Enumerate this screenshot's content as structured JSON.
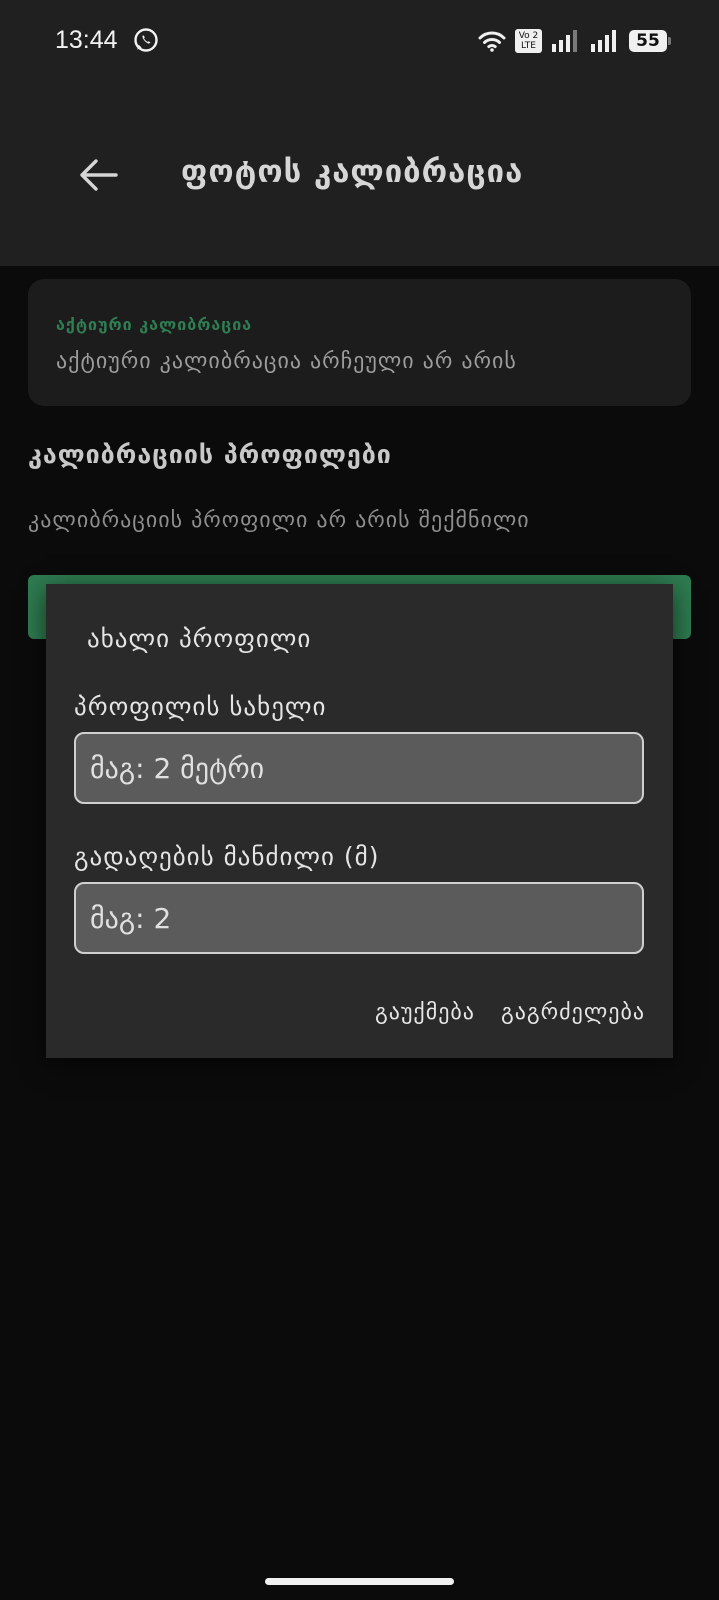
{
  "status_bar": {
    "time": "13:44",
    "volte_line1": "Vo 2",
    "volte_line2": "LTE",
    "battery": "55"
  },
  "app_bar": {
    "title": "ფოტოს კალიბრაცია"
  },
  "active_calibration": {
    "label": "აქტიური კალიბრაცია",
    "value": "აქტიური კალიბრაცია არჩეული არ არის"
  },
  "profiles": {
    "title": "კალიბრაციის პროფილები",
    "empty_text": "კალიბრაციის პროფილი არ არის შექმნილი"
  },
  "dialog": {
    "title": "ახალი პროფილი",
    "name_label": "პროფილის სახელი",
    "name_placeholder": "მაგ: 2 მეტრი",
    "distance_label": "გადაღების მანძილი (მ)",
    "distance_placeholder": "მაგ: 2",
    "cancel_label": "გაუქმება",
    "continue_label": "გაგრძელება"
  },
  "colors": {
    "accent_green": "#2e7b50",
    "label_green": "#2f7d52",
    "bar_background": "#202020",
    "page_background": "#0b0b0b",
    "dialog_background": "#2a2a2a"
  }
}
